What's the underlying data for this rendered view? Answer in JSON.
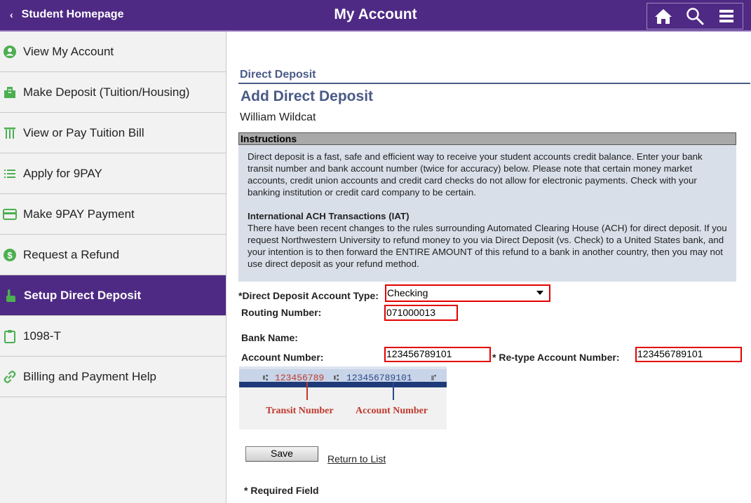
{
  "header": {
    "back_label": "Student Homepage",
    "title": "My Account",
    "icons": [
      "home-icon",
      "search-icon",
      "menu-icon"
    ]
  },
  "sidebar": {
    "items": [
      {
        "label": "View My Account",
        "icon": "user-circle-icon"
      },
      {
        "label": "Make Deposit (Tuition/Housing)",
        "icon": "building-icon"
      },
      {
        "label": "View or Pay Tuition Bill",
        "icon": "columns-icon"
      },
      {
        "label": "Apply for 9PAY",
        "icon": "list-icon"
      },
      {
        "label": "Make 9PAY Payment",
        "icon": "credit-card-icon"
      },
      {
        "label": "Request a Refund",
        "icon": "dollar-circle-icon"
      },
      {
        "label": "Setup Direct Deposit",
        "icon": "hand-pointer-icon",
        "active": true
      },
      {
        "label": "1098-T",
        "icon": "clipboard-icon"
      },
      {
        "label": "Billing and Payment Help",
        "icon": "link-icon"
      }
    ]
  },
  "main": {
    "section_title": "Direct Deposit",
    "page_title": "Add Direct Deposit",
    "student_name": "William Wildcat",
    "instructions": {
      "heading": "Instructions",
      "paragraph1": "Direct deposit is a fast, safe and efficient way to receive your student accounts credit balance. Enter your bank transit number and bank account number (twice for accuracy) below. Please note that certain money market accounts, credit union accounts and credit card checks do not allow for electronic payments. Check with your banking institution or credit card company to be certain.",
      "iat_heading": "International ACH Transactions (IAT)",
      "paragraph2": "There have been recent changes to the rules surrounding Automated Clearing House (ACH) for direct deposit. If you request Northwestern University to refund money to you via Direct Deposit (vs. Check) to a United States bank, and your intention is to then forward the ENTIRE AMOUNT of this refund to a bank in another country, then you may not use direct deposit as your refund method."
    },
    "form": {
      "account_type_label": "*Direct Deposit Account Type:",
      "account_type_value": "Checking",
      "routing_label": "Routing Number:",
      "routing_value": "071000013",
      "bank_name_label": "Bank Name:",
      "account_label": "Account Number:",
      "account_value": "123456789101",
      "retype_label": "* Re-type Account Number:",
      "retype_value": "123456789101"
    },
    "check_image": {
      "transit_digits": "123456789",
      "account_digits": "123456789101",
      "transit_caption": "Transit Number",
      "account_caption": "Account Number"
    },
    "save_label": "Save",
    "return_label": "Return to List",
    "required_note": "* Required Field"
  },
  "colors": {
    "brand_purple": "#4e2a84",
    "section_blue": "#4a5a87",
    "highlight_red": "#e30000",
    "icon_green": "#4caf50",
    "instructions_bg": "#d8dfe9"
  }
}
